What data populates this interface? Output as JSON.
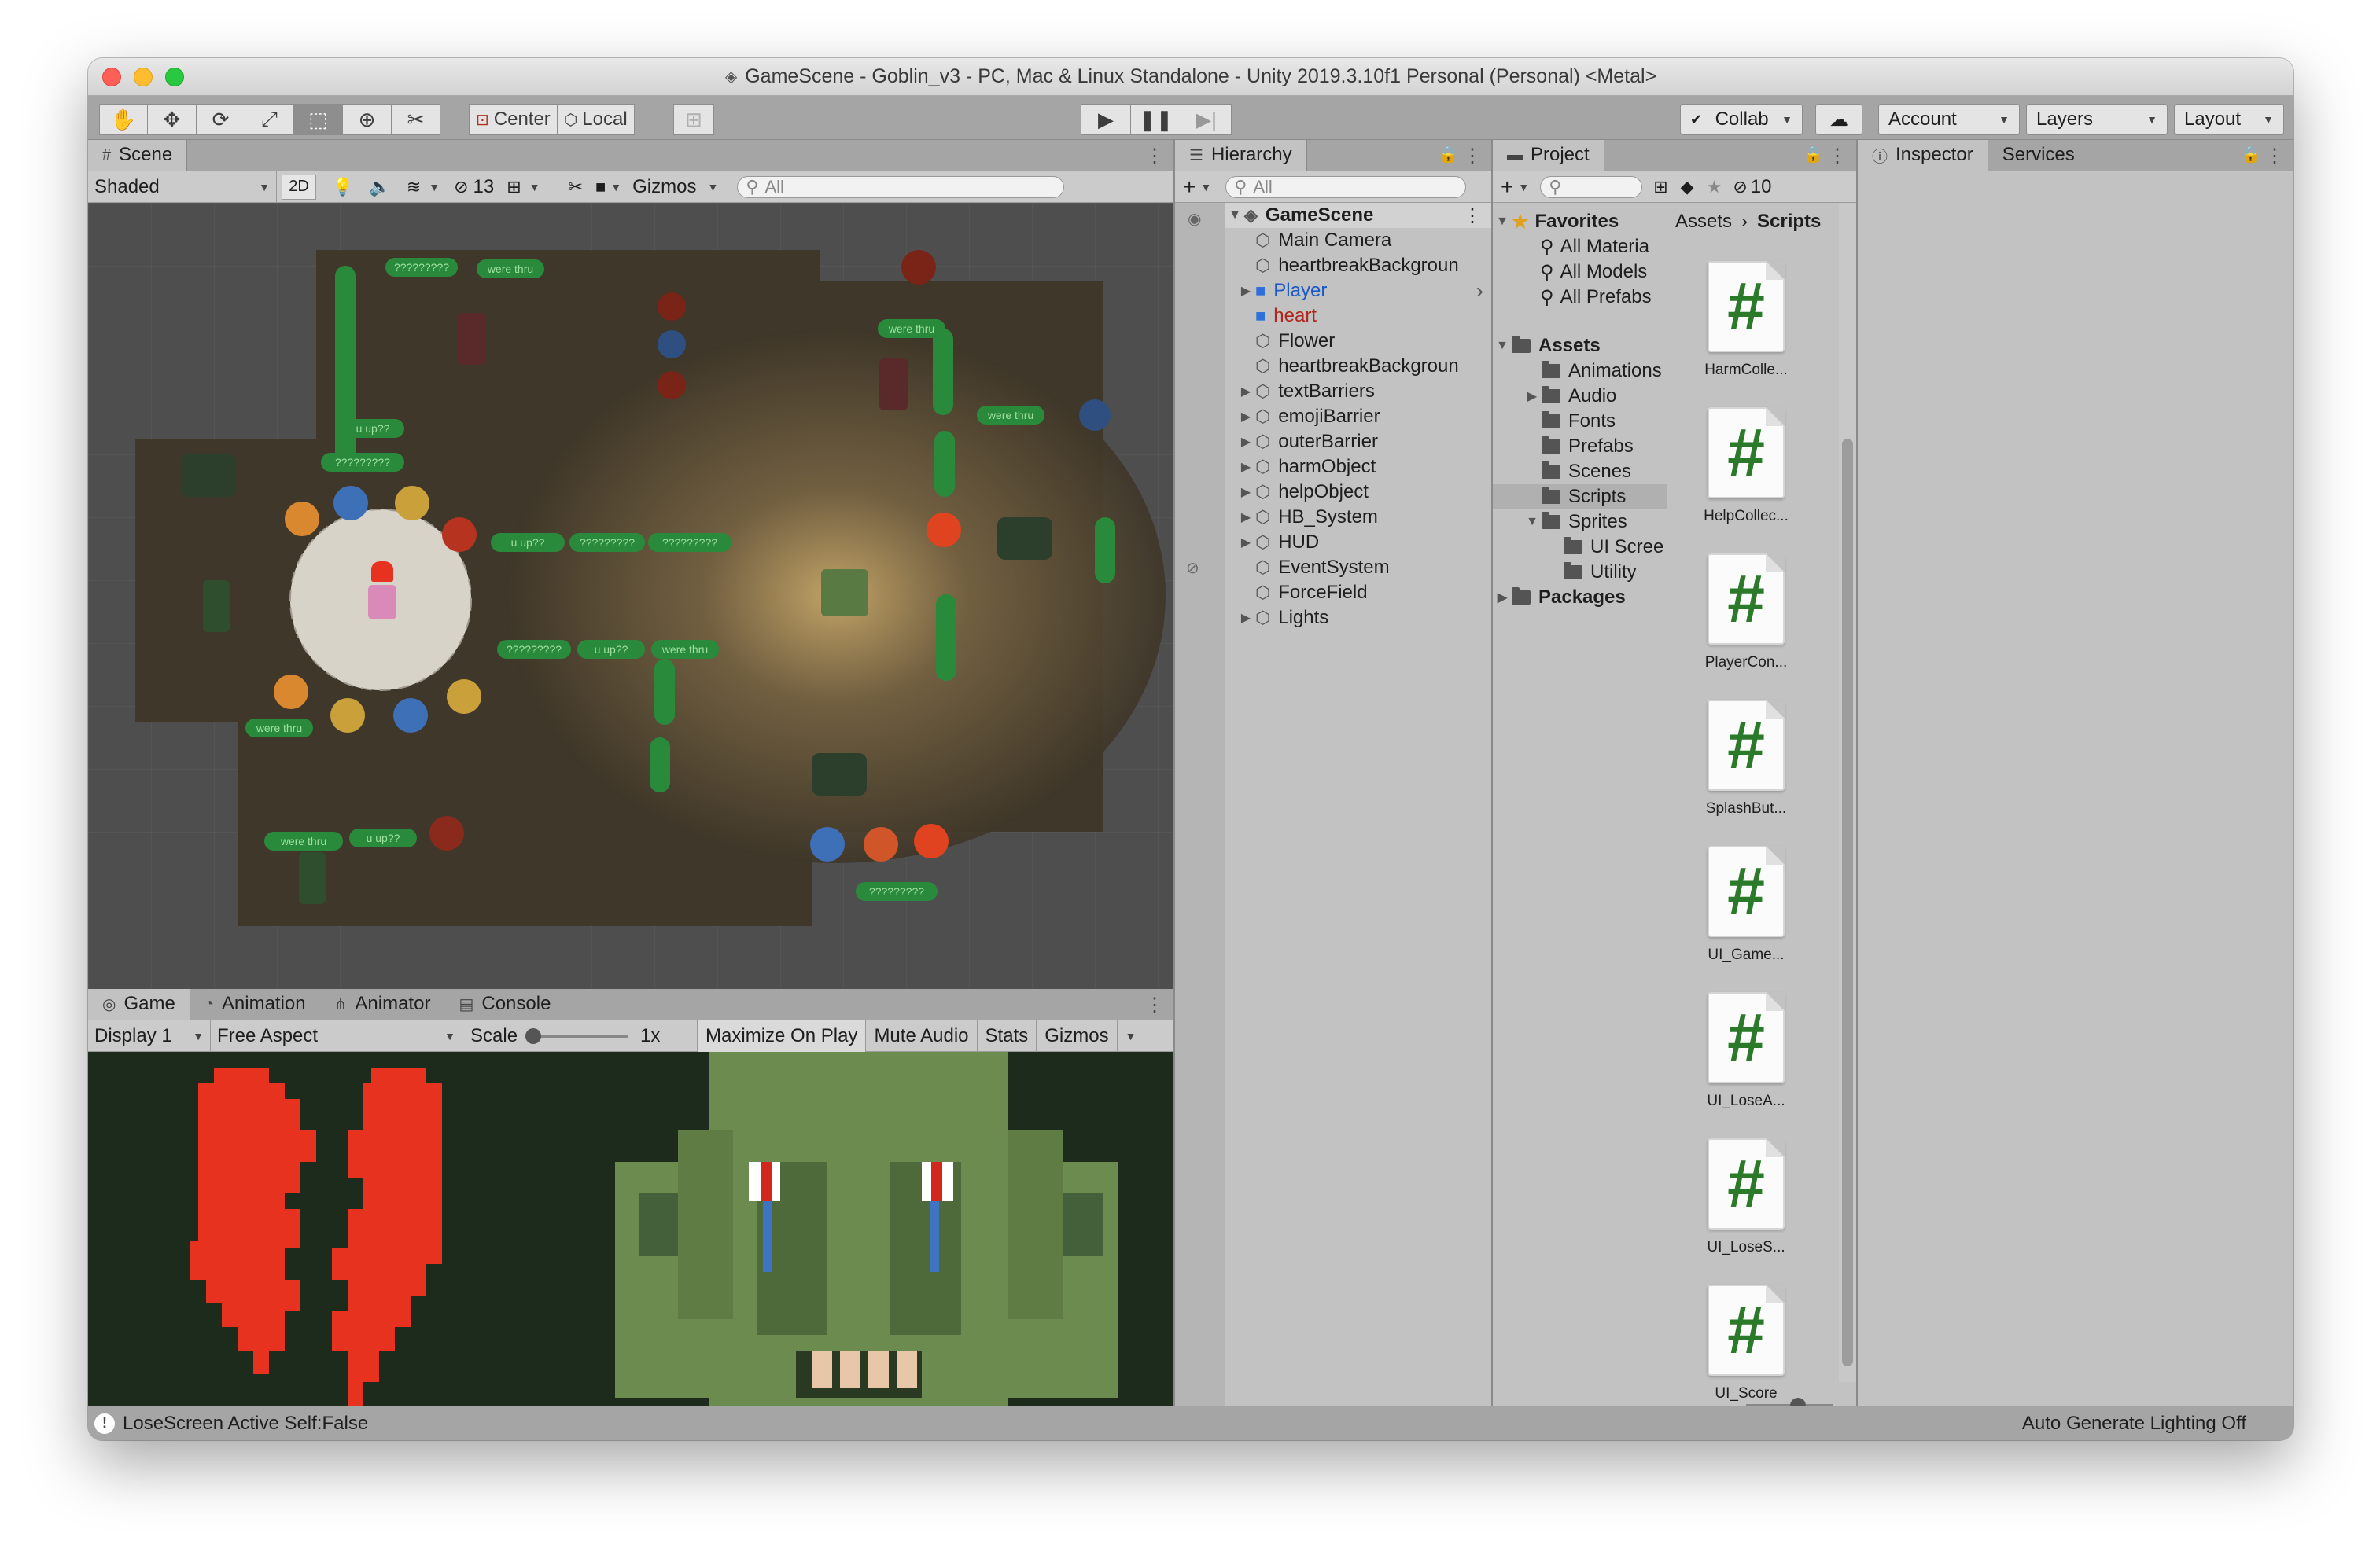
{
  "window": {
    "title": "GameScene - Goblin_v3 - PC, Mac & Linux Standalone - Unity 2019.3.10f1 Personal (Personal) <Metal>"
  },
  "toolbar": {
    "tools": [
      "hand-tool",
      "move-tool",
      "rotate-tool",
      "scale-tool",
      "rect-tool",
      "transform-tool",
      "custom-tool"
    ],
    "pivot_center": "Center",
    "pivot_local": "Local",
    "collab": "Collab",
    "account": "Account",
    "layers": "Layers",
    "layout": "Layout"
  },
  "scene": {
    "tab": "Scene",
    "shading": "Shaded",
    "mode_2d": "2D",
    "hidden_count": "13",
    "gizmos": "Gizmos",
    "search_placeholder": "All"
  },
  "game": {
    "tabs": [
      "Game",
      "Animation",
      "Animator",
      "Console"
    ],
    "display": "Display 1",
    "aspect": "Free Aspect",
    "scale_label": "Scale",
    "scale_value": "1x",
    "maximize": "Maximize On Play",
    "mute": "Mute Audio",
    "stats": "Stats",
    "gizmos": "Gizmos"
  },
  "hierarchy": {
    "tab": "Hierarchy",
    "search_placeholder": "All",
    "scene_name": "GameScene",
    "items": [
      {
        "label": "Main Camera",
        "expandable": false,
        "style": ""
      },
      {
        "label": "heartbreakBackgroun",
        "expandable": false,
        "style": ""
      },
      {
        "label": "Player",
        "expandable": true,
        "style": "blue"
      },
      {
        "label": "heart",
        "expandable": false,
        "style": "red"
      },
      {
        "label": "Flower",
        "expandable": false,
        "style": ""
      },
      {
        "label": "heartbreakBackgroun",
        "expandable": false,
        "style": ""
      },
      {
        "label": "textBarriers",
        "expandable": true,
        "style": ""
      },
      {
        "label": "emojiBarrier",
        "expandable": true,
        "style": ""
      },
      {
        "label": "outerBarrier",
        "expandable": true,
        "style": ""
      },
      {
        "label": "harmObject",
        "expandable": true,
        "style": ""
      },
      {
        "label": "helpObject",
        "expandable": true,
        "style": ""
      },
      {
        "label": "HB_System",
        "expandable": true,
        "style": ""
      },
      {
        "label": "HUD",
        "expandable": true,
        "style": ""
      },
      {
        "label": "EventSystem",
        "expandable": false,
        "style": ""
      },
      {
        "label": "ForceField",
        "expandable": false,
        "style": ""
      },
      {
        "label": "Lights",
        "expandable": true,
        "style": ""
      }
    ]
  },
  "project": {
    "tab": "Project",
    "hidden_count": "10",
    "favorites": {
      "label": "Favorites",
      "items": [
        "All Materia",
        "All Models",
        "All Prefabs"
      ]
    },
    "assets": {
      "label": "Assets",
      "items": [
        "Animations",
        "Audio",
        "Fonts",
        "Prefabs",
        "Scenes",
        "Scripts",
        "Sprites"
      ],
      "sprites_children": [
        "UI Scree",
        "Utility"
      ]
    },
    "packages": "Packages",
    "breadcrumb": [
      "Assets",
      "Scripts"
    ],
    "scripts": [
      "HarmColle...",
      "HelpCollec...",
      "PlayerCon...",
      "SplashBut...",
      "UI_Game...",
      "UI_LoseA...",
      "UI_LoseS...",
      "UI_Score"
    ]
  },
  "inspector": {
    "tab": "Inspector",
    "services_tab": "Services"
  },
  "status": {
    "message": "LoseScreen Active Self:False",
    "lighting": "Auto Generate Lighting Off"
  },
  "scene_labels": {
    "q1": "?????????",
    "q2": "?????????",
    "q3": "?????????",
    "q4": "?????????",
    "q5": "?????????",
    "q6": "?????????",
    "uup1": "u up??",
    "uup2": "u up??",
    "uup3": "u up??",
    "uup4": "u up??",
    "were1": "were thru",
    "were2": "were thru",
    "were3": "were thru",
    "were4": "were thru",
    "were5": "were thru",
    "were6": "were thru"
  },
  "colors": {
    "panel_bg": "#c2c2c2",
    "toolbar_bg": "#a5a5a5",
    "heart_red": "#e6321e",
    "goblin_green": "#6b8c4e",
    "game_bg": "#1d2b1d",
    "pill_green": "#2a8a3c"
  }
}
